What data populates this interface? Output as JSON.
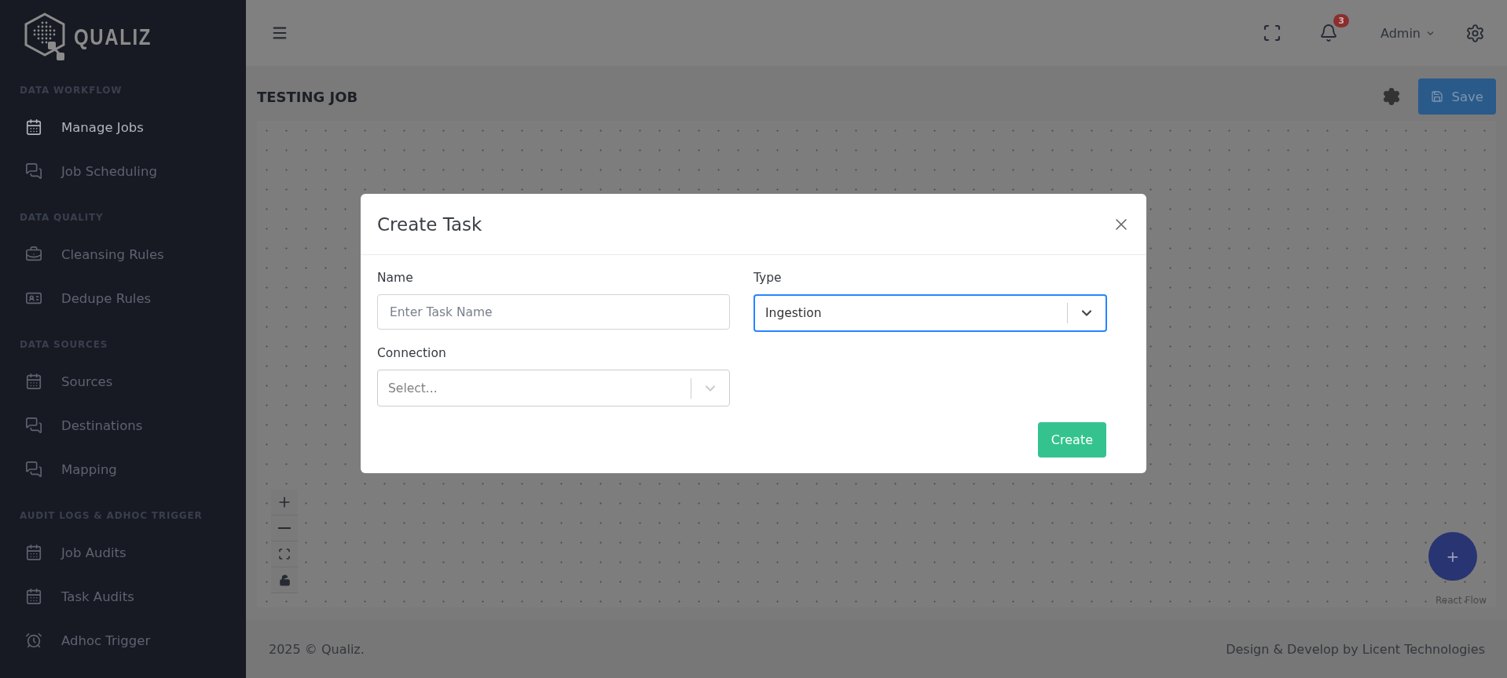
{
  "brand": {
    "name": "QUALIZ"
  },
  "sidebar": {
    "sections": [
      {
        "title": "DATA WORKFLOW",
        "items": [
          {
            "label": "Manage Jobs",
            "selected": true
          },
          {
            "label": "Job Scheduling",
            "selected": false
          }
        ]
      },
      {
        "title": "DATA QUALITY",
        "items": [
          {
            "label": "Cleansing Rules",
            "selected": false
          },
          {
            "label": "Dedupe Rules",
            "selected": false
          }
        ]
      },
      {
        "title": "DATA SOURCES",
        "items": [
          {
            "label": "Sources",
            "selected": false
          },
          {
            "label": "Destinations",
            "selected": false
          },
          {
            "label": "Mapping",
            "selected": false
          }
        ]
      },
      {
        "title": "AUDIT LOGS & ADHOC TRIGGER",
        "items": [
          {
            "label": "Job Audits",
            "selected": false
          },
          {
            "label": "Task Audits",
            "selected": false
          },
          {
            "label": "Adhoc Trigger",
            "selected": false
          }
        ]
      }
    ]
  },
  "topbar": {
    "notification_count": "3",
    "user": "Admin"
  },
  "page": {
    "title": "TESTING JOB",
    "save_label": "Save"
  },
  "canvas": {
    "add_label": "+",
    "attribution": "React Flow"
  },
  "modal": {
    "title": "Create Task",
    "fields": [
      {
        "label": "Name",
        "kind": "text",
        "placeholder": "Enter Task Name"
      },
      {
        "label": "Type",
        "kind": "select",
        "value": "Ingestion",
        "focused": true
      },
      {
        "label": "Connection",
        "kind": "select",
        "placeholder": "Select...",
        "focused": false
      }
    ],
    "submit": "Create"
  },
  "footer": {
    "left": "2025 © Qualiz.",
    "right": "Design & Develop by Licent Technologies"
  }
}
